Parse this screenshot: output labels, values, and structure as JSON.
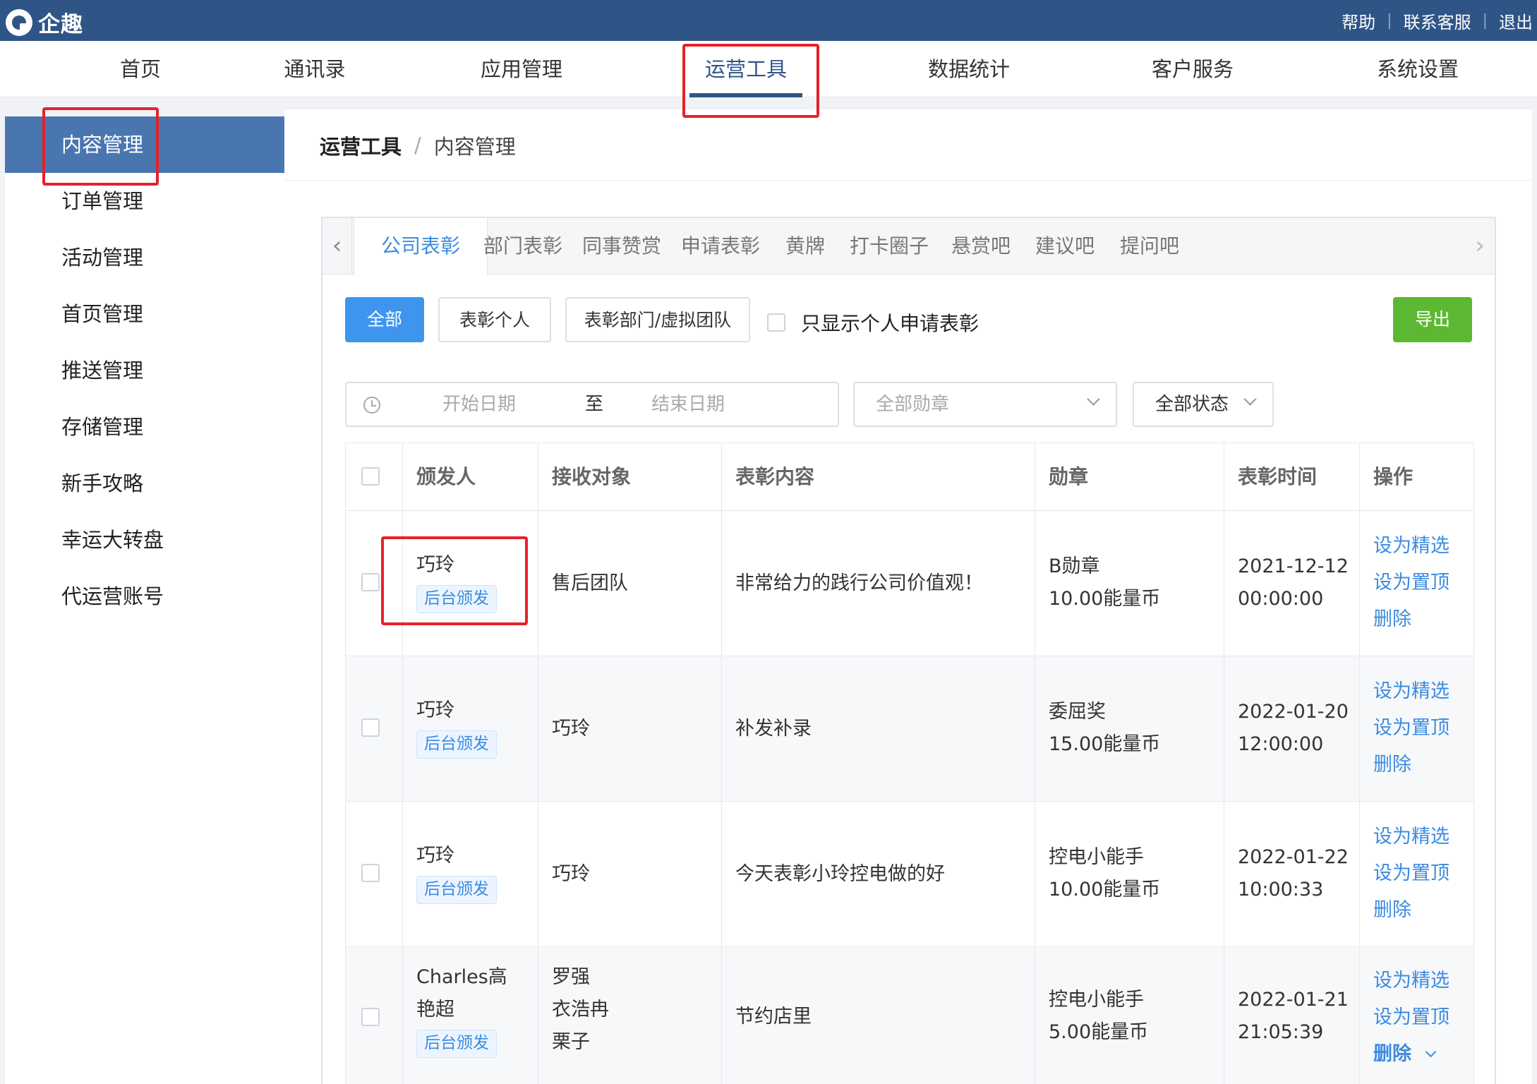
{
  "app": {
    "logo_text": "企趣"
  },
  "top_links": [
    "帮助",
    "联系客服",
    "退出"
  ],
  "main_nav": [
    {
      "label": "首页"
    },
    {
      "label": "通讯录"
    },
    {
      "label": "应用管理"
    },
    {
      "label": "运营工具",
      "active": true
    },
    {
      "label": "数据统计"
    },
    {
      "label": "客户服务"
    },
    {
      "label": "系统设置"
    }
  ],
  "sidebar": [
    {
      "label": "内容管理",
      "active": true
    },
    {
      "label": "订单管理"
    },
    {
      "label": "活动管理"
    },
    {
      "label": "首页管理"
    },
    {
      "label": "推送管理"
    },
    {
      "label": "存储管理"
    },
    {
      "label": "新手攻略"
    },
    {
      "label": "幸运大转盘"
    },
    {
      "label": "代运营账号"
    }
  ],
  "breadcrumb": {
    "parent": "运营工具",
    "separator": "/",
    "current": "内容管理"
  },
  "tabs": [
    {
      "label": "公司表彰",
      "active": true
    },
    {
      "label": "部门表彰"
    },
    {
      "label": "同事赞赏"
    },
    {
      "label": "申请表彰"
    },
    {
      "label": "黄牌"
    },
    {
      "label": "打卡圈子"
    },
    {
      "label": "悬赏吧"
    },
    {
      "label": "建议吧"
    },
    {
      "label": "提问吧"
    }
  ],
  "filters": {
    "all_label": "全部",
    "individual_label": "表彰个人",
    "dept_label": "表彰部门/虚拟团队",
    "only_personal_label": "只显示个人申请表彰",
    "export_label": "导出",
    "start_date_placeholder": "开始日期",
    "to_label": "至",
    "end_date_placeholder": "结束日期",
    "medal_placeholder": "全部勋章",
    "status_value": "全部状态"
  },
  "table": {
    "columns": [
      "颁发人",
      "接收对象",
      "表彰内容",
      "勋章",
      "表彰时间",
      "操作"
    ],
    "rows": [
      {
        "issuer": [
          "巧玲"
        ],
        "tag": "后台颁发",
        "receiver": [
          "售后团队"
        ],
        "content": "非常给力的践行公司价值观！",
        "medal": "B勋章",
        "coins": "10.00能量币",
        "date": "2021-12-12",
        "time": "00:00:00"
      },
      {
        "issuer": [
          "巧玲"
        ],
        "tag": "后台颁发",
        "receiver": [
          "巧玲"
        ],
        "content": "补发补录",
        "medal": "委屈奖",
        "coins": "15.00能量币",
        "date": "2022-01-20",
        "time": "12:00:00"
      },
      {
        "issuer": [
          "巧玲"
        ],
        "tag": "后台颁发",
        "receiver": [
          "巧玲"
        ],
        "content": "今天表彰小玲控电做的好",
        "medal": "控电小能手",
        "coins": "10.00能量币",
        "date": "2022-01-22",
        "time": "10:00:33"
      },
      {
        "issuer": [
          "Charles高",
          "艳超"
        ],
        "tag": "后台颁发",
        "receiver": [
          "罗强",
          "衣浩冉",
          "栗子"
        ],
        "content": "节约店里",
        "medal": "控电小能手",
        "coins": "5.00能量币",
        "date": "2022-01-21",
        "time": "21:05:39"
      }
    ],
    "ops": {
      "featured": "设为精选",
      "pin": "设为置顶",
      "delete": "删除"
    }
  },
  "colors": {
    "brand": "#2f5587",
    "accent": "#3c8be0",
    "primary_btn": "#3d95ee",
    "export_btn": "#5cb832",
    "highlight": "#e5222a"
  }
}
